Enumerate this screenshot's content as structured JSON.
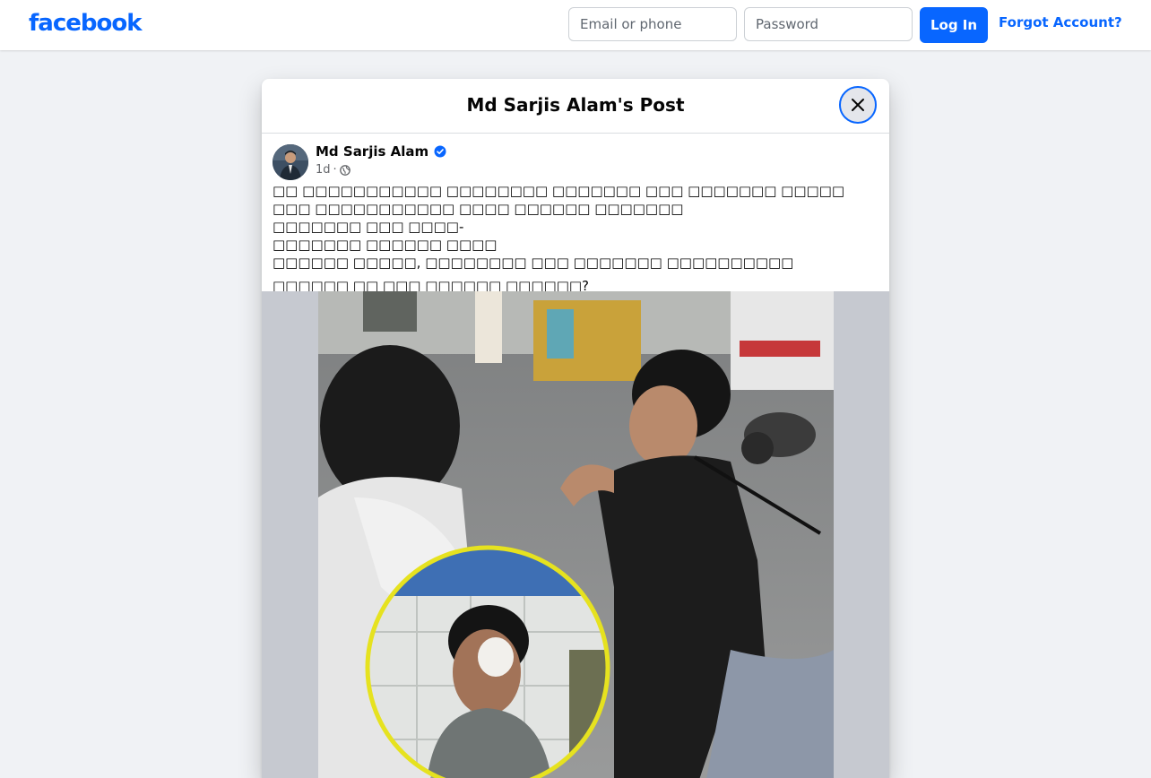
{
  "header": {
    "logo": "facebook",
    "email_placeholder": "Email or phone",
    "password_placeholder": "Password",
    "login_label": "Log In",
    "forgot_label": "Forgot Account?"
  },
  "dialog": {
    "title": "Md Sarjis Alam's Post",
    "close_icon": "close-icon"
  },
  "post": {
    "author": "Md Sarjis Alam",
    "verified_icon": "verified-badge-icon",
    "time": "1d",
    "separator": "·",
    "audience_icon": "globe-icon",
    "text_lines": [
      "□□ □□□□□□□□□□□ □□□□□□□□ □□□□□□□ □□□ □□□□□□□ □□□□□ □□□ □□□□□□□□□□□ □□□□ □□□□□□ □□□□□□□",
      "□□□□□□□ □□□ □□□□-",
      "□□□□□□□ □□□□□□ □□□□",
      "□□□□□□ □□□□□, □□□□□□□□ □□□ □□□□□□□ □□□□□□□□□□"
    ],
    "question": "□□□□□□ □□ □□□ □□□□□□ □□□□□□?",
    "media": "photo of a street altercation with circular inset of an injured young man"
  },
  "colors": {
    "brand_blue": "#0866ff",
    "page_bg": "#f0f2f5",
    "media_bg": "#c6c9d0"
  }
}
